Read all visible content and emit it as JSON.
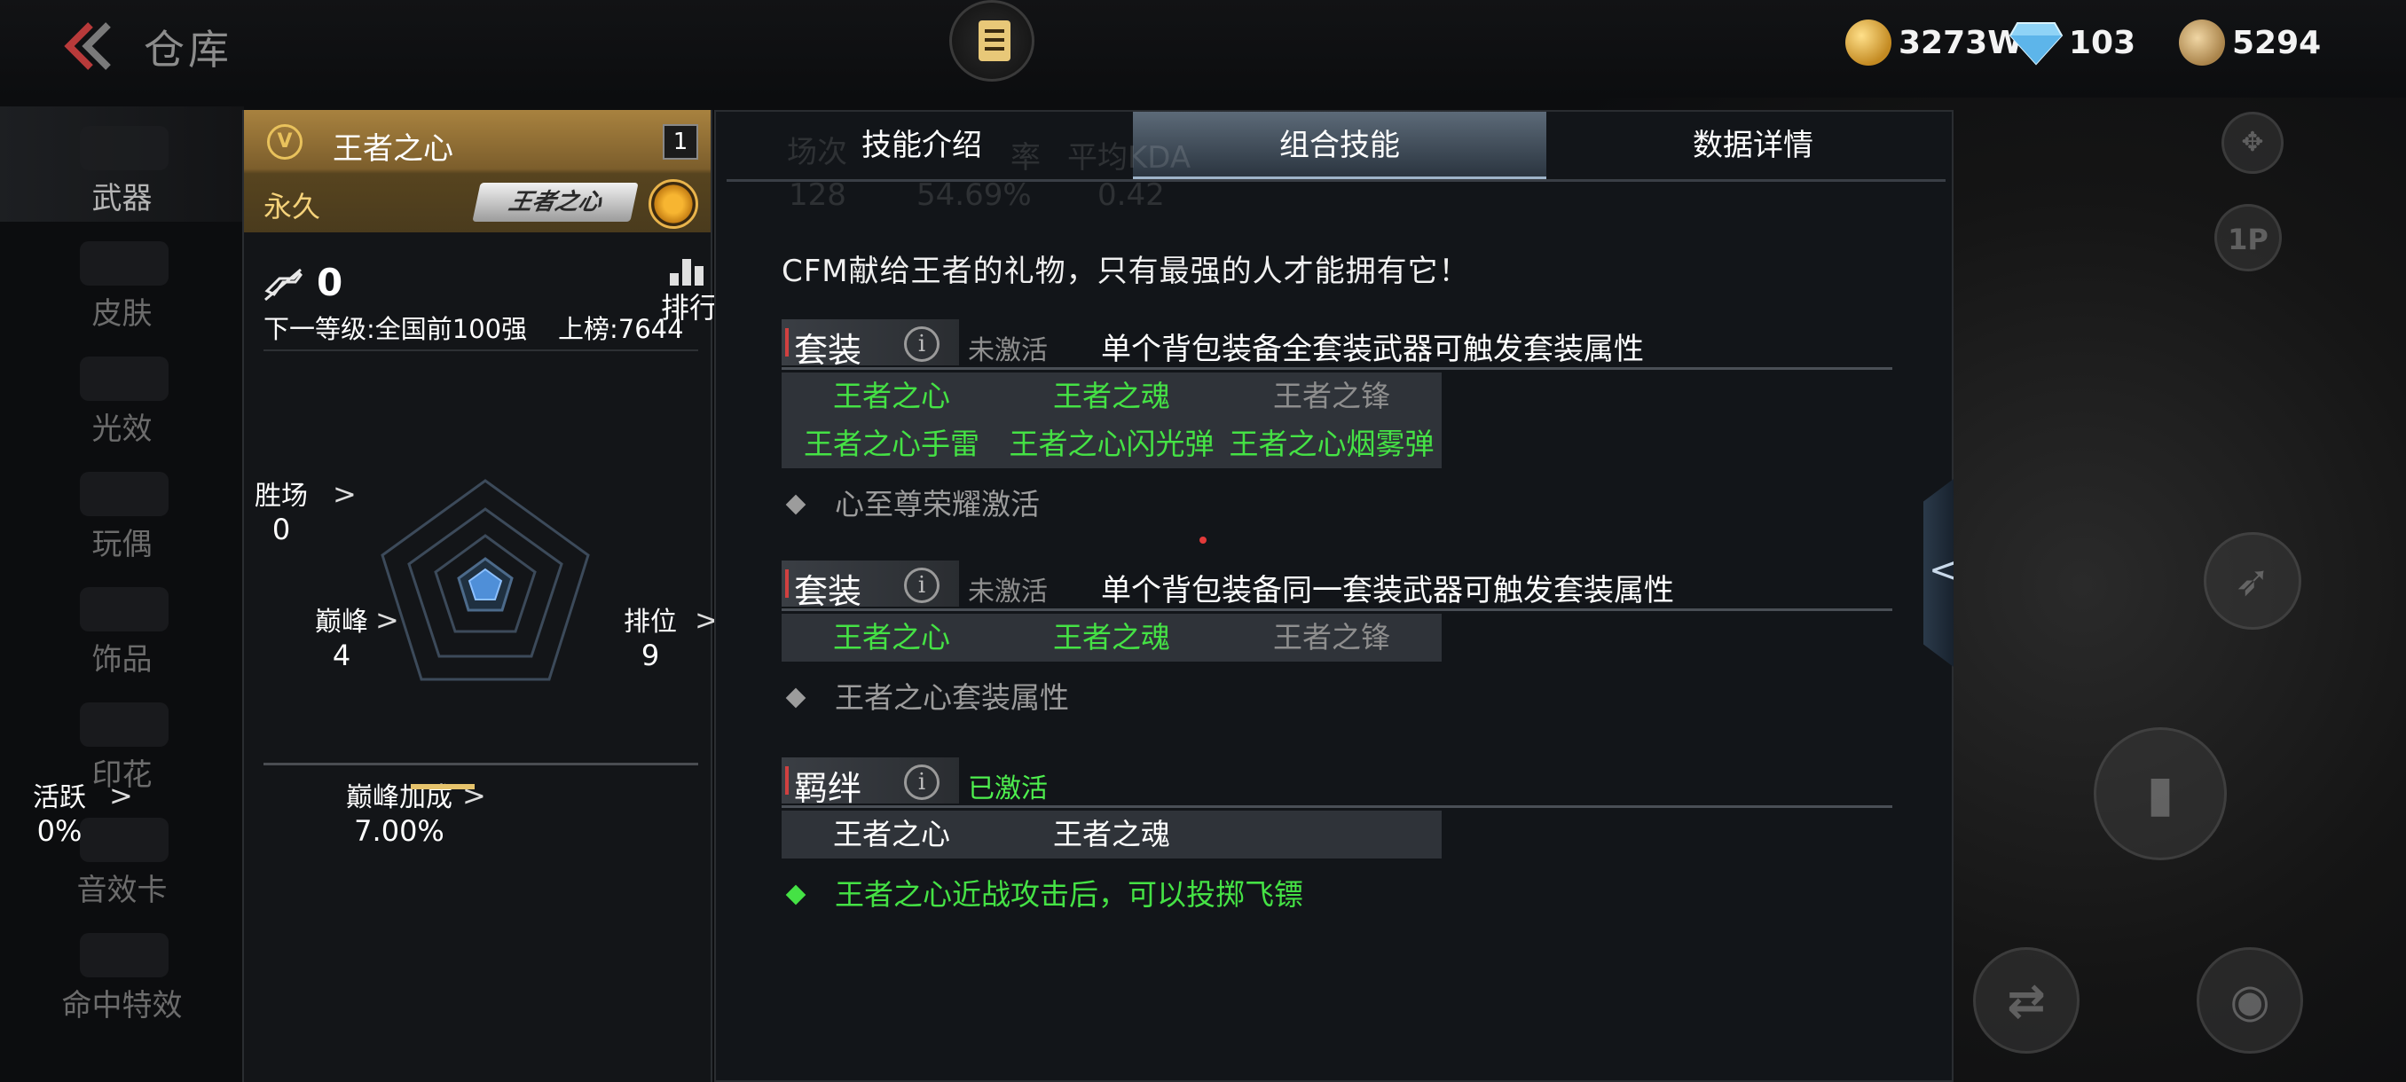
{
  "header": {
    "title": "仓库",
    "currency": [
      {
        "icon": "gold-coin-icon",
        "value": "3273W",
        "color": "#e2b24c"
      },
      {
        "icon": "diamond-icon",
        "value": "103",
        "color": "#7ec8f0"
      },
      {
        "icon": "medal-coin-icon",
        "value": "5294",
        "color": "#c7a260"
      }
    ]
  },
  "nav": {
    "items": [
      {
        "label": "武器",
        "active": true
      },
      {
        "label": "皮肤"
      },
      {
        "label": "光效"
      },
      {
        "label": "玩偶"
      },
      {
        "label": "饰品"
      },
      {
        "label": "印花"
      },
      {
        "label": "音效卡"
      },
      {
        "label": "命中特效"
      }
    ]
  },
  "card": {
    "name": "王者之心",
    "count": "1",
    "duration": "永久",
    "badge": "王者之心",
    "kills": "0",
    "rank_label": "排行",
    "next_level": "下一等级:全国前100强",
    "onboard": "上榜:7644",
    "stats": {
      "wins": {
        "label": "胜场",
        "value": "0"
      },
      "peak": {
        "label": "巅峰",
        "value": "4"
      },
      "ranked": {
        "label": "排位",
        "value": "9"
      },
      "peak_bonus": {
        "label": "巅峰加成",
        "value": "7.00%"
      },
      "active": {
        "label": "活跃",
        "value": "0%"
      }
    }
  },
  "panel": {
    "tabs": [
      {
        "label": "技能介绍"
      },
      {
        "label": "组合技能",
        "active": true
      },
      {
        "label": "数据详情"
      }
    ],
    "ghost": {
      "matches": "场次",
      "matches_val": "128",
      "rate": "率",
      "rate_val": "54.69%",
      "kda": "平均KDA",
      "kda_val": "0.42"
    },
    "description": "CFM献给王者的礼物，只有最强的人才能拥有它！",
    "sections": [
      {
        "tag": "套装",
        "status": "未激活",
        "rule": "单个背包装备全套装武器可触发套装属性",
        "items": [
          {
            "label": "王者之心",
            "state": "g"
          },
          {
            "label": "王者之魂",
            "state": "g"
          },
          {
            "label": "王者之锋",
            "state": "d"
          },
          {
            "label": "王者之心手雷",
            "state": "g"
          },
          {
            "label": "王者之心闪光弹",
            "state": "g"
          },
          {
            "label": "王者之心烟雾弹",
            "state": "g"
          }
        ],
        "effect": "心至尊荣耀激活"
      },
      {
        "tag": "套装",
        "status": "未激活",
        "rule": "单个背包装备同一套装武器可触发套装属性",
        "items": [
          {
            "label": "王者之心",
            "state": "g"
          },
          {
            "label": "王者之魂",
            "state": "g"
          },
          {
            "label": "王者之锋",
            "state": "d"
          }
        ],
        "effect": "王者之心套装属性"
      },
      {
        "tag": "羁绊",
        "status": "已激活",
        "rule": "",
        "items": [
          {
            "label": "王者之心",
            "state": "w"
          },
          {
            "label": "王者之魂",
            "state": "w"
          }
        ],
        "effect": "王者之心近战攻击后，可以投掷飞镖"
      }
    ]
  },
  "right": {
    "view_label": "1P"
  }
}
